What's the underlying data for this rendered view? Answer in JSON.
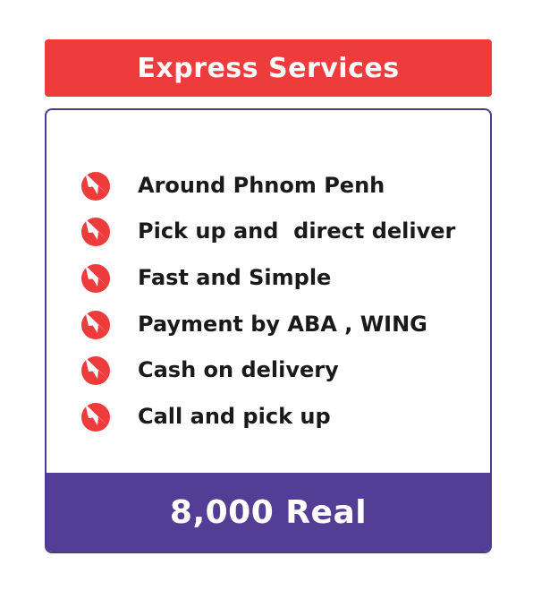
{
  "header": {
    "title": "Express Services"
  },
  "features": [
    {
      "label": "Around Phnom Penh",
      "icon": "delivery-arrow-icon"
    },
    {
      "label": "Pick up and  direct deliver",
      "icon": "delivery-arrow-icon"
    },
    {
      "label": "Fast and Simple",
      "icon": "delivery-arrow-icon"
    },
    {
      "label": "Payment by ABA , WING",
      "icon": "delivery-arrow-icon"
    },
    {
      "label": "Cash on delivery",
      "icon": "delivery-arrow-icon"
    },
    {
      "label": "Call and pick up",
      "icon": "delivery-arrow-icon"
    }
  ],
  "price": {
    "label": "8,000 Real"
  },
  "colors": {
    "header": "#ee3b3b",
    "accent": "#543d94",
    "border": "#4a3c8c",
    "icon": "#ee3b3b"
  }
}
